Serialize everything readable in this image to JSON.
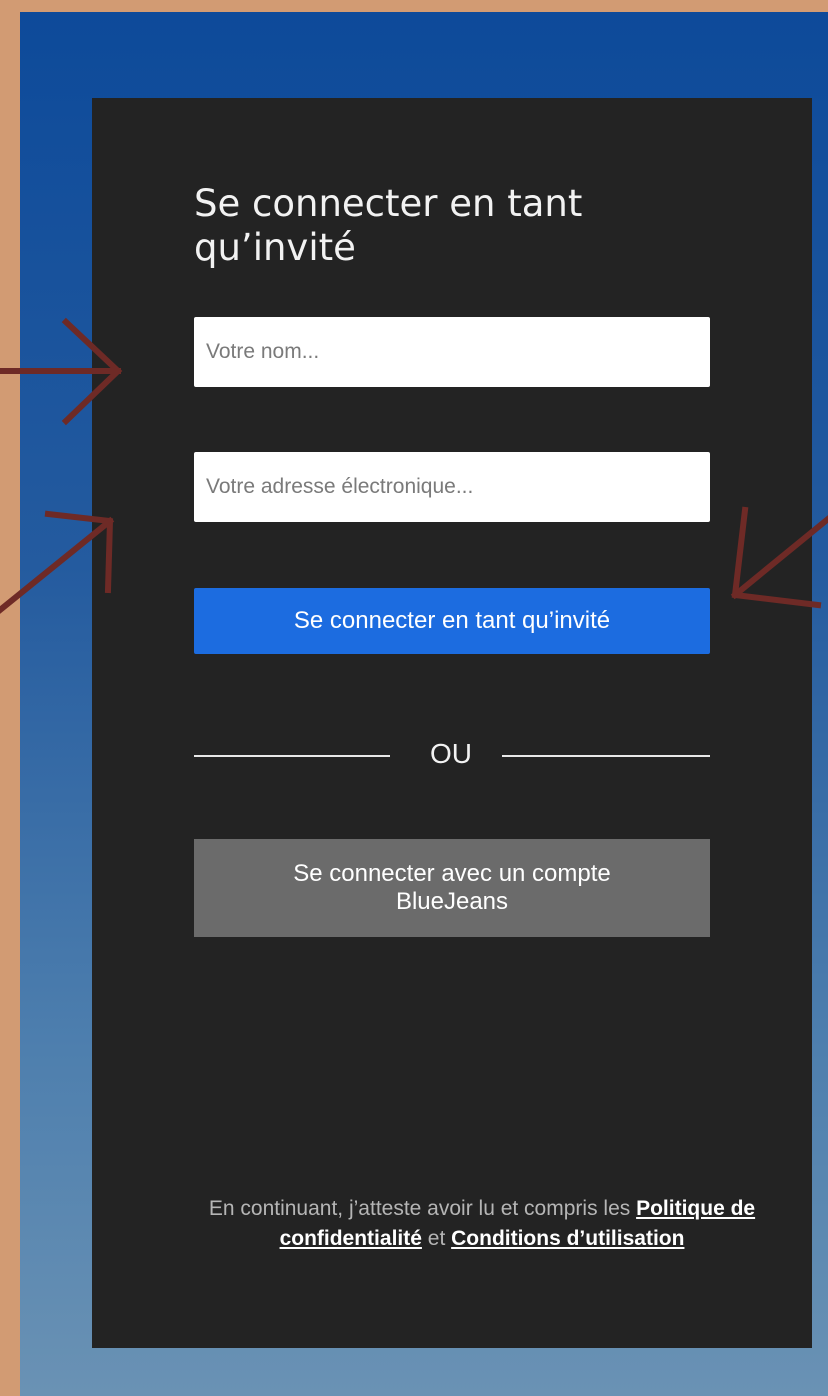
{
  "login": {
    "title": "Se connecter en tant qu’invité",
    "name_placeholder": "Votre nom...",
    "email_placeholder": "Votre adresse électronique...",
    "guest_button": "Se connecter en tant qu’invité",
    "divider_text": "OU",
    "account_button": "Se connecter avec un compte BlueJeans"
  },
  "footer": {
    "text_before": "En continuant, j’atteste avoir lu et compris les",
    "privacy_link": "Politique de confidentialité",
    "and_text": "et",
    "terms_link": "Conditions d’utilisation"
  },
  "colors": {
    "page_background": "#d29b73",
    "gradient_top": "#0d4a9a",
    "panel": "#232323",
    "primary_button": "#1c6ce0",
    "secondary_button": "#6b6b6b",
    "annotation_arrows": "#6e2a26"
  },
  "annotations": {
    "arrow_icons": [
      "arrow-right-icon",
      "arrow-up-right-icon",
      "arrow-down-left-icon"
    ]
  }
}
